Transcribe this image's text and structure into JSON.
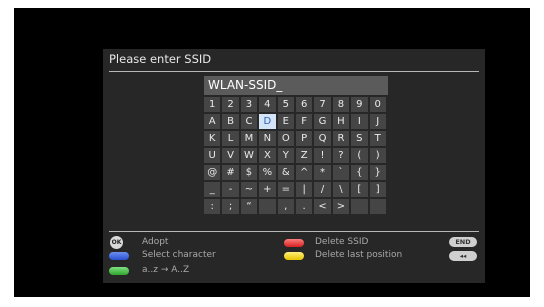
{
  "dialog": {
    "title": "Please enter SSID"
  },
  "ssid": {
    "value": "WLAN-SSID_"
  },
  "keyboard": {
    "selected": "D",
    "rows": [
      [
        "1",
        "2",
        "3",
        "4",
        "5",
        "6",
        "7",
        "8",
        "9",
        "0"
      ],
      [
        "A",
        "B",
        "C",
        "D",
        "E",
        "F",
        "G",
        "H",
        "I",
        "J"
      ],
      [
        "K",
        "L",
        "M",
        "N",
        "O",
        "P",
        "Q",
        "R",
        "S",
        "T"
      ],
      [
        "U",
        "V",
        "W",
        "X",
        "Y",
        "Z",
        "!",
        "?",
        "(",
        ")"
      ],
      [
        "@",
        "#",
        "$",
        "%",
        "&",
        "^",
        "*",
        "`",
        "{",
        "}"
      ],
      [
        "_",
        "-",
        "~",
        "+",
        "=",
        "|",
        "/",
        "\\",
        "[",
        "]"
      ],
      [
        ":",
        ";",
        "“",
        "",
        ",",
        ".",
        "<",
        ">",
        "",
        ""
      ]
    ]
  },
  "legend": {
    "ok_icon_text": "OK",
    "adopt": "Adopt",
    "select_character": "Select character",
    "case_toggle": "a..z → A..Z",
    "delete_ssid": "Delete SSID",
    "delete_last": "Delete last position",
    "end_key": "END",
    "back_key": "◂◂"
  },
  "colors": {
    "blue": "#2a4fd0",
    "green": "#2ea42e",
    "red": "#d72020",
    "yellow": "#e6c400",
    "selected_key": "#d2e4f6"
  }
}
